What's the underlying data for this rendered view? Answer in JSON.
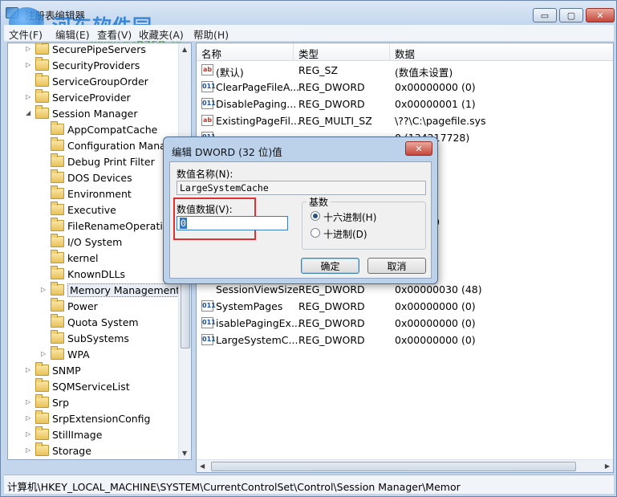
{
  "window": {
    "title": "注册表编辑器",
    "controls": {
      "minimize": "▭",
      "maximize": "▢",
      "close": "✕"
    }
  },
  "watermark": {
    "text": "河东软件园",
    "url": "www.pc0359.cn"
  },
  "menubar": [
    "文件(F)",
    "编辑(E)",
    "查看(V)",
    "收藏夹(A)",
    "帮助(H)"
  ],
  "tree": {
    "items": [
      {
        "label": "SecurePipeServers",
        "level": 1,
        "expander": "▷"
      },
      {
        "label": "SecurityProviders",
        "level": 1,
        "expander": "▷"
      },
      {
        "label": "ServiceGroupOrder",
        "level": 1,
        "expander": ""
      },
      {
        "label": "ServiceProvider",
        "level": 1,
        "expander": "▷"
      },
      {
        "label": "Session Manager",
        "level": 1,
        "expander": "◢"
      },
      {
        "label": "AppCompatCache",
        "level": 2,
        "expander": ""
      },
      {
        "label": "Configuration Manag",
        "level": 2,
        "expander": ""
      },
      {
        "label": "Debug Print Filter",
        "level": 2,
        "expander": ""
      },
      {
        "label": "DOS Devices",
        "level": 2,
        "expander": ""
      },
      {
        "label": "Environment",
        "level": 2,
        "expander": ""
      },
      {
        "label": "Executive",
        "level": 2,
        "expander": ""
      },
      {
        "label": "FileRenameOperation",
        "level": 2,
        "expander": ""
      },
      {
        "label": "I/O System",
        "level": 2,
        "expander": ""
      },
      {
        "label": "kernel",
        "level": 2,
        "expander": ""
      },
      {
        "label": "KnownDLLs",
        "level": 2,
        "expander": ""
      },
      {
        "label": "Memory Management",
        "level": 2,
        "expander": "▷",
        "selected": true
      },
      {
        "label": "Power",
        "level": 2,
        "expander": ""
      },
      {
        "label": "Quota System",
        "level": 2,
        "expander": ""
      },
      {
        "label": "SubSystems",
        "level": 2,
        "expander": ""
      },
      {
        "label": "WPA",
        "level": 2,
        "expander": "▷"
      },
      {
        "label": "SNMP",
        "level": 1,
        "expander": "▷"
      },
      {
        "label": "SQMServiceList",
        "level": 1,
        "expander": ""
      },
      {
        "label": "Srp",
        "level": 1,
        "expander": "▷"
      },
      {
        "label": "SrpExtensionConfig",
        "level": 1,
        "expander": "▷"
      },
      {
        "label": "StillImage",
        "level": 1,
        "expander": "▷"
      },
      {
        "label": "Storage",
        "level": 1,
        "expander": "▷"
      }
    ]
  },
  "list": {
    "columns": {
      "name": "名称",
      "type": "类型",
      "data": "数据"
    },
    "rows": [
      {
        "icon": "ab",
        "kind": "sz",
        "name": "(默认)",
        "type": "REG_SZ",
        "data": "(数值未设置)"
      },
      {
        "icon": "011",
        "kind": "dword",
        "name": "ClearPageFileA...",
        "type": "REG_DWORD",
        "data": "0x00000000 (0)"
      },
      {
        "icon": "011",
        "kind": "dword",
        "name": "DisablePaging...",
        "type": "REG_DWORD",
        "data": "0x00000001 (1)"
      },
      {
        "icon": "ab",
        "kind": "sz",
        "name": "ExistingPageFil...",
        "type": "REG_MULTI_SZ",
        "data": "\\??\\C:\\pagefile.sys"
      },
      {
        "icon": "011",
        "kind": "dword",
        "name": "",
        "type": "",
        "data": "0 (134217728)"
      },
      {
        "icon": "",
        "kind": "",
        "name": "",
        "type": "",
        "data": "(0)"
      },
      {
        "icon": "",
        "kind": "",
        "name": "",
        "type": "",
        "data": "(0)"
      },
      {
        "icon": "",
        "kind": "",
        "name": "",
        "type": "",
        "data": "(0)"
      },
      {
        "icon": "",
        "kind": "",
        "name": "",
        "type": "",
        "data": "(0)"
      },
      {
        "icon": "",
        "kind": "",
        "name": "",
        "type": "",
        "data": "e.sys 0 0"
      },
      {
        "icon": "",
        "kind": "",
        "name": "",
        "type": "",
        "data": "01 (1)"
      },
      {
        "icon": "",
        "kind": "",
        "name": "",
        "type": "",
        "data": "(0)"
      },
      {
        "icon": "",
        "kind": "",
        "name": "",
        "type": "",
        "data": "04 (4)"
      },
      {
        "icon": "",
        "kind": "",
        "name": "SessionViewSize",
        "type": "REG_DWORD",
        "data": "0x00000030 (48)"
      },
      {
        "icon": "011",
        "kind": "dword",
        "name": "SystemPages",
        "type": "REG_DWORD",
        "data": "0x00000000 (0)"
      },
      {
        "icon": "011",
        "kind": "dword",
        "name": "isablePagingEx...",
        "type": "REG_DWORD",
        "data": "0x00000000 (0)"
      },
      {
        "icon": "011",
        "kind": "dword",
        "name": "LargeSystemC...",
        "type": "REG_DWORD",
        "data": "0x00000000 (0)"
      }
    ]
  },
  "dialog": {
    "title": "编辑 DWORD (32 位)值",
    "close": "✕",
    "value_name_label": "数值名称(N):",
    "value_name": "LargeSystemCache",
    "value_data_label": "数值数据(V):",
    "value_data": "0",
    "base_label": "基数",
    "radio_hex": "十六进制(H)",
    "radio_dec": "十进制(D)",
    "base_selected": "hex",
    "ok": "确定",
    "cancel": "取消"
  },
  "status": {
    "path": "计算机\\HKEY_LOCAL_MACHINE\\SYSTEM\\CurrentControlSet\\Control\\Session Manager\\Memor"
  }
}
